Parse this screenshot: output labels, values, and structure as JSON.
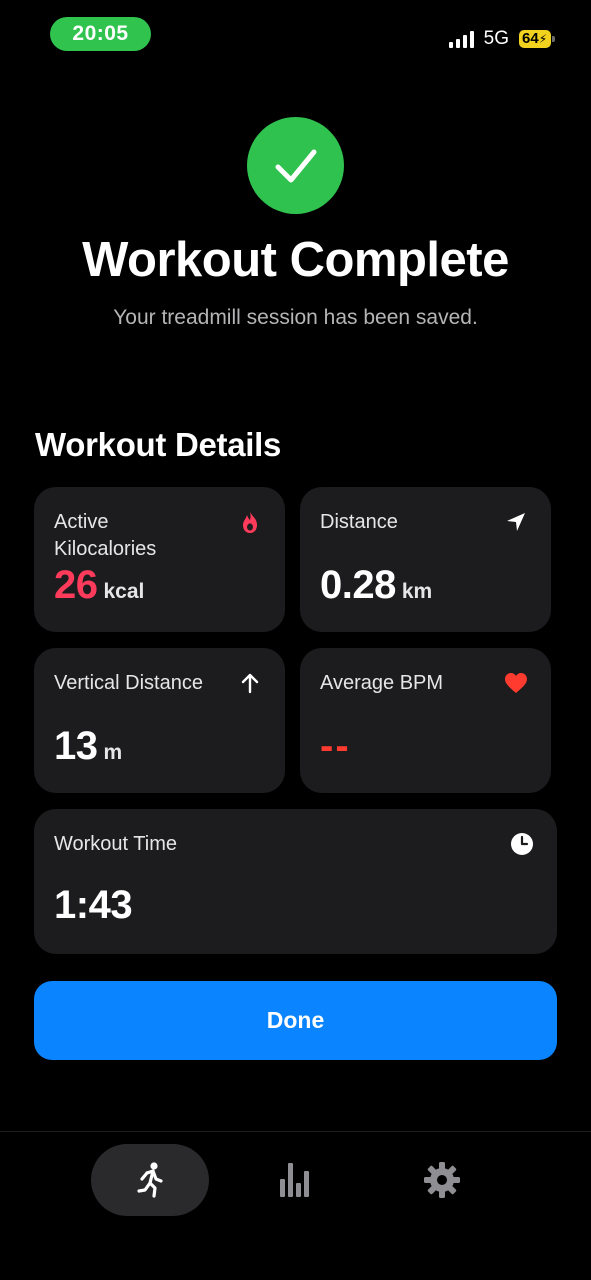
{
  "status_bar": {
    "time": "20:05",
    "network": "5G",
    "battery": "64"
  },
  "header": {
    "title": "Workout Complete",
    "subtitle": "Your treadmill session has been saved."
  },
  "details": {
    "section_title": "Workout Details",
    "active_kcal": {
      "label": "Active Kilocalories",
      "value": "26",
      "unit": "kcal",
      "icon": "flame-icon"
    },
    "distance": {
      "label": "Distance",
      "value": "0.28",
      "unit": "km",
      "icon": "location-arrow-icon"
    },
    "vertical_distance": {
      "label": "Vertical Distance",
      "value": "13",
      "unit": "m",
      "icon": "arrow-up-icon"
    },
    "average_bpm": {
      "label": "Average BPM",
      "value": "--",
      "icon": "heart-icon"
    },
    "workout_time": {
      "label": "Workout Time",
      "value": "1:43",
      "icon": "clock-icon"
    }
  },
  "done_label": "Done",
  "tab_bar": {
    "items": [
      {
        "icon": "running-figure-icon",
        "active": true
      },
      {
        "icon": "bar-chart-icon",
        "active": false
      },
      {
        "icon": "gear-icon",
        "active": false
      }
    ]
  },
  "colors": {
    "accent_blue": "#0a84ff",
    "success_green": "#2fc24e",
    "kcal_red": "#ff3b5c",
    "heart_red": "#ff3b30",
    "card_bg": "#1c1c1e"
  }
}
